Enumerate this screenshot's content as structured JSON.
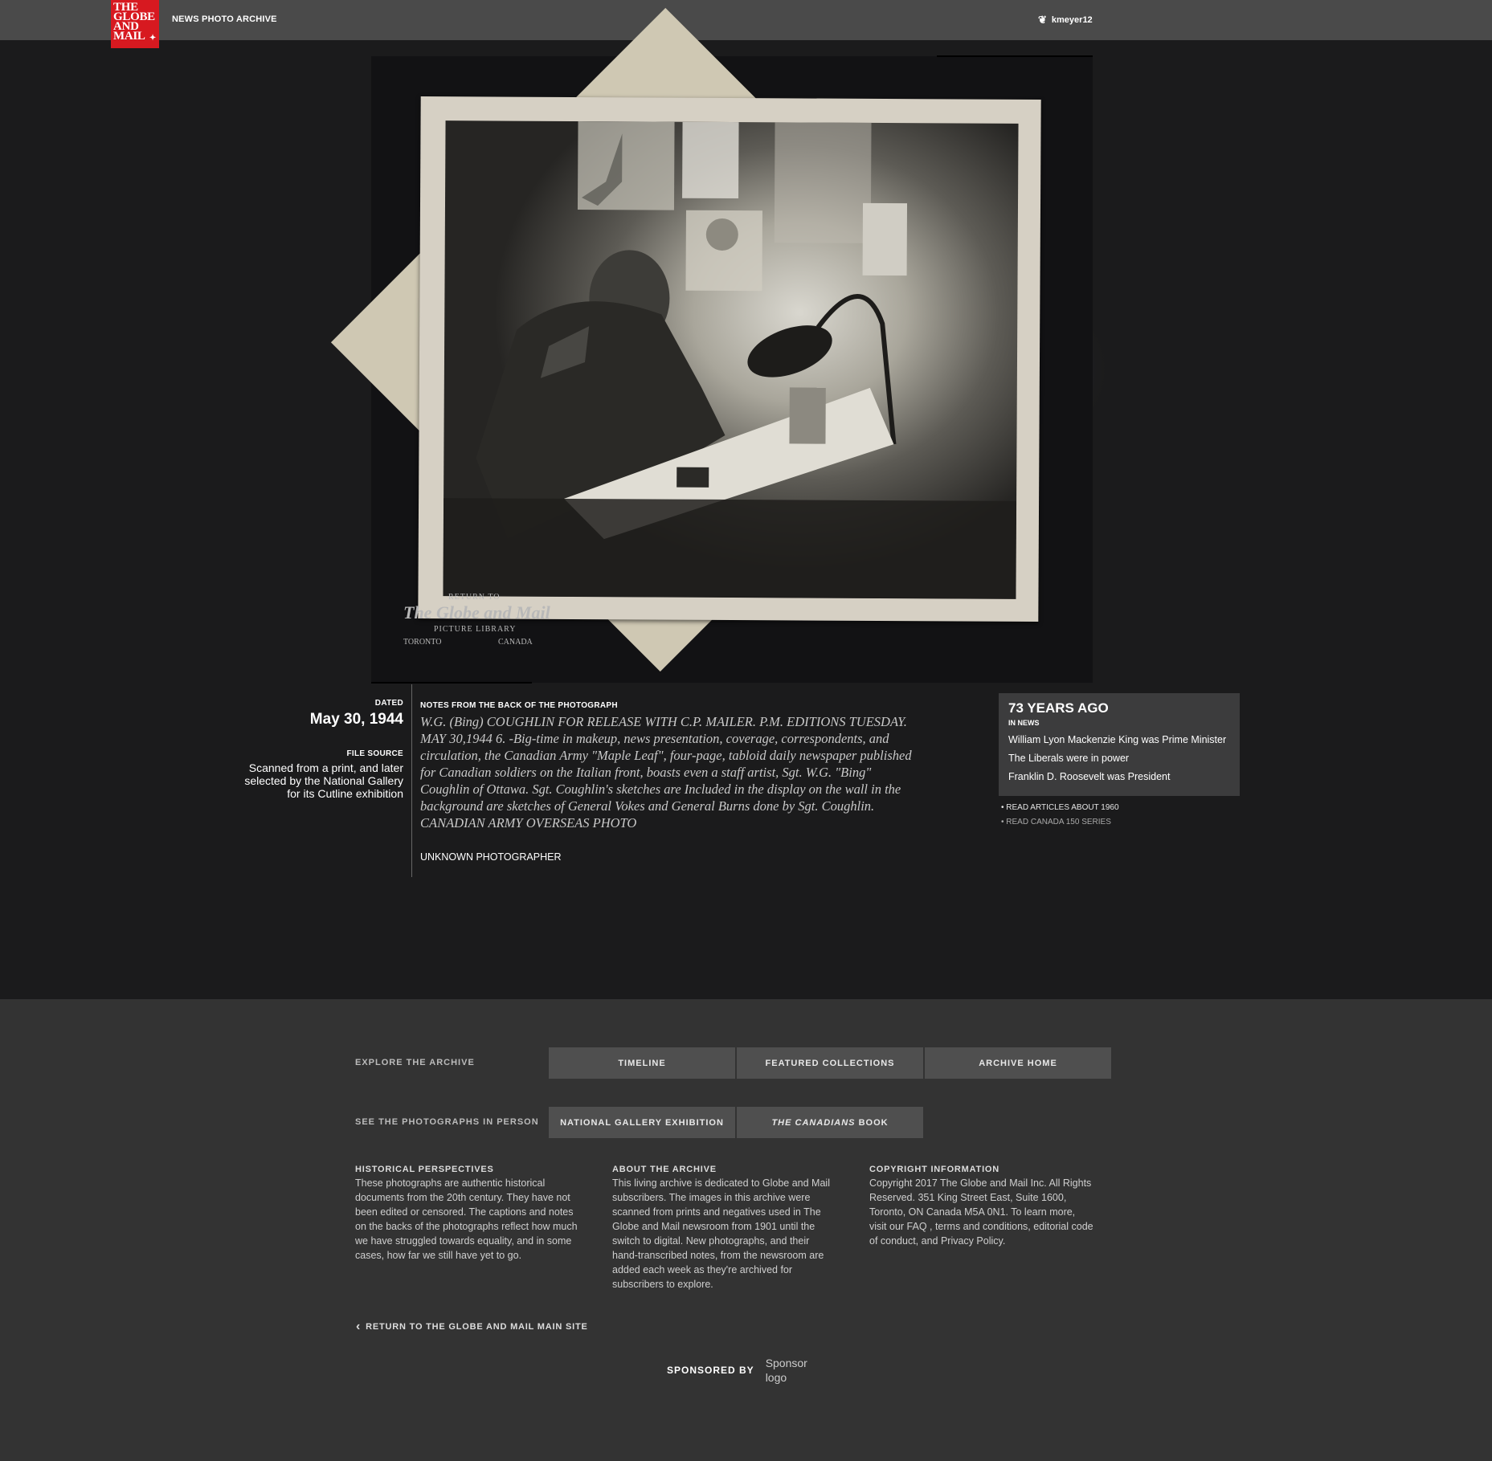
{
  "header": {
    "logo_lines": [
      "THE",
      "GLOBE",
      "AND",
      "MAIL"
    ],
    "section_title": "NEWS PHOTO ARCHIVE",
    "username": "kmeyer12"
  },
  "photo": {
    "stamp": {
      "return_to": "RETURN TO",
      "paper": "The Globe and Mail",
      "library": "PICTURE LIBRARY",
      "city": "TORONTO",
      "country": "CANADA"
    }
  },
  "meta": {
    "dated_label": "DATED",
    "date": "May 30, 1944",
    "file_source_label": "FILE SOURCE",
    "file_source": "Scanned from a print, and later selected by the National Gallery for its Cutline exhibition"
  },
  "notes": {
    "label": "NOTES FROM THE BACK OF THE PHOTOGRAPH",
    "text": "W.G. (Bing) COUGHLIN FOR RELEASE WITH C.P. MAILER. P.M. EDITIONS TUESDAY. MAY 30,1944 6. -Big-time in makeup, news presentation, coverage, correspondents, and circulation, the Canadian Army \"Maple Leaf\", four-page, tabloid daily newspaper published for Canadian soldiers on the Italian front, boasts even a staff artist, Sgt. W.G. \"Bing\" Coughlin of Ottawa. Sgt. Coughlin's sketches are Included in the display on the wall in the background are sketches of General Vokes and General Burns done by Sgt. Coughlin. CANADIAN ARMY OVERSEAS PHOTO",
    "photographer": "UNKNOWN PHOTOGRAPHER"
  },
  "years_ago": {
    "title": "73 YEARS AGO",
    "subtitle": "IN NEWS",
    "facts": [
      "William Lyon Mackenzie King was Prime Minister",
      "The Liberals were in power",
      "Franklin D. Roosevelt was President"
    ],
    "links": [
      "READ ARTICLES ABOUT 1960",
      "READ CANADA 150 SERIES"
    ]
  },
  "footer": {
    "explore_label": "EXPLORE THE ARCHIVE",
    "explore_buttons": [
      "TIMELINE",
      "FEATURED COLLECTIONS",
      "ARCHIVE HOME"
    ],
    "inperson_label": "SEE THE PHOTOGRAPHS IN PERSON",
    "inperson_buttons": [
      "NATIONAL GALLERY EXHIBITION",
      "THE CANADIANS",
      "BOOK"
    ],
    "columns": [
      {
        "heading": "HISTORICAL PERSPECTIVES",
        "text": "These photographs are authentic historical documents from the 20th century. They have not been edited or censored. The captions and notes on the backs of the photographs reflect how much we have struggled towards equality, and in some cases, how far we still have yet to go."
      },
      {
        "heading": "ABOUT THE ARCHIVE",
        "text": "This living archive is dedicated to Globe and Mail subscribers. The images in this archive were scanned from prints and negatives used in The Globe and Mail newsroom from 1901 until the switch to digital. New photographs, and their hand-transcribed notes, from the newsroom are added each week as they're archived for subscribers to explore."
      },
      {
        "heading": "COPYRIGHT INFORMATION",
        "text": "Copyright 2017 The Globe and Mail Inc. All Rights Reserved. 351 King Street East, Suite 1600, Toronto, ON Canada M5A 0N1. To learn more, visit our FAQ , terms and conditions, editorial code of conduct, and Privacy Policy."
      }
    ],
    "return_link": "RETURN TO THE GLOBE AND MAIL MAIN SITE",
    "sponsored_by": "SPONSORED BY",
    "sponsor_logo": "Sponsor logo"
  }
}
